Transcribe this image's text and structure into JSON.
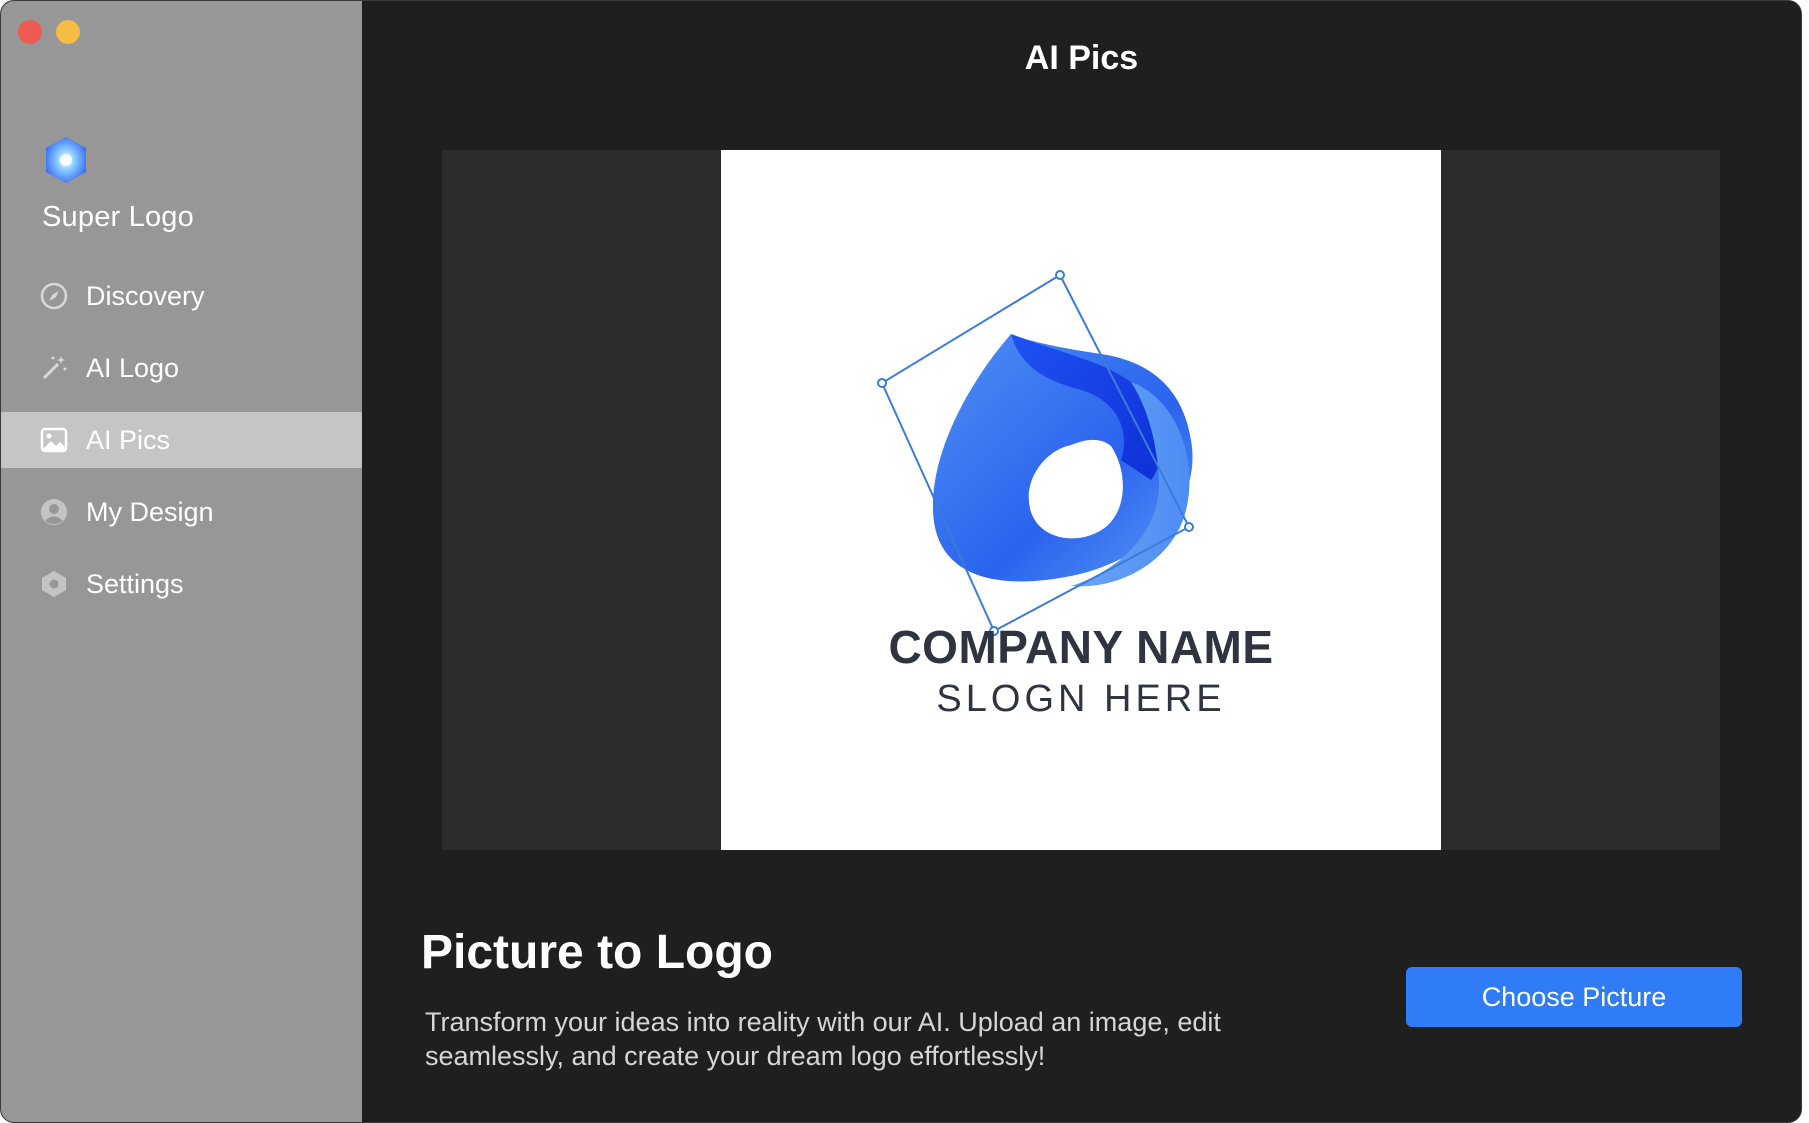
{
  "app": {
    "name": "Super Logo"
  },
  "sidebar": {
    "items": [
      {
        "label": "Discovery",
        "icon": "compass-icon",
        "active": false
      },
      {
        "label": "AI Logo",
        "icon": "magic-wand-icon",
        "active": false
      },
      {
        "label": "AI Pics",
        "icon": "image-icon",
        "active": true
      },
      {
        "label": "My Design",
        "icon": "user-circle-icon",
        "active": false
      },
      {
        "label": "Settings",
        "icon": "hexagon-settings-icon",
        "active": false
      }
    ]
  },
  "main": {
    "title": "AI Pics",
    "preview": {
      "company_name": "COMPANY NAME",
      "slogan": "SLOGN HERE"
    },
    "feature": {
      "title": "Picture to Logo",
      "description": "Transform your ideas into reality with our AI. Upload an image, edit seamlessly, and create your dream logo effortlessly!",
      "button_label": "Choose Picture"
    }
  },
  "colors": {
    "sidebar_bg": "#979797",
    "active_item_bg": "#c5c5c5",
    "main_bg": "#1f1f1f",
    "accent": "#2f7cf6",
    "logo_blue": "#1f5cf0"
  }
}
